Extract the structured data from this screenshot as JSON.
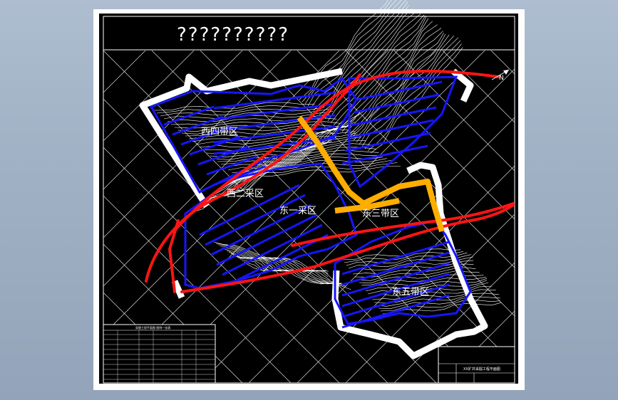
{
  "drawing": {
    "title": "??????????",
    "regions": [
      {
        "id": "west-4",
        "label": "西四带区"
      },
      {
        "id": "west-2",
        "label": "西二采区"
      },
      {
        "id": "east-1",
        "label": "东一采区"
      },
      {
        "id": "east-3",
        "label": "东三带区"
      },
      {
        "id": "east-5",
        "label": "东五带区"
      }
    ],
    "north_label": "N",
    "legend_title": "采掘工程平面图 图例一览表",
    "titleblock_name": "XX矿井采掘工程平面图",
    "colors": {
      "background": "#000000",
      "panel_outline": "#1616ff",
      "roadway": "#ff1414",
      "main_shaft": "#ffae00",
      "contour": "#ffffff",
      "mine_boundary": "#ffffff"
    }
  }
}
